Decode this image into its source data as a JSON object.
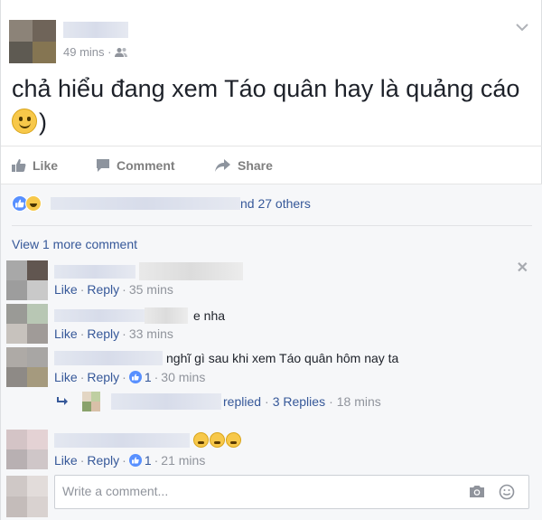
{
  "post": {
    "timestamp": "49 mins · ",
    "audience_icon": "friends-icon",
    "text": "chả hiểu đang xem Táo quân hay là quảng cáo",
    "text_suffix": ")",
    "emoji": "smile-icon"
  },
  "actions": {
    "like": "Like",
    "comment": "Comment",
    "share": "Share"
  },
  "reactions": {
    "summary_suffix": "nd 27 others"
  },
  "view_more": "View 1 more comment",
  "comments": [
    {
      "text": "",
      "like": "Like",
      "reply": "Reply",
      "time": "35 mins"
    },
    {
      "text": "e nha",
      "like": "Like",
      "reply": "Reply",
      "time": "33 mins"
    },
    {
      "text": "nghĩ gì sau khi xem Táo quân hôm nay ta",
      "like": "Like",
      "reply": "Reply",
      "like_count": "1",
      "time": "30 mins",
      "replies_text": "replied",
      "replies_link": "3 Replies",
      "replies_time": "18 mins"
    },
    {
      "text": "",
      "like": "Like",
      "reply": "Reply",
      "like_count": "1",
      "time": "21 mins"
    }
  ],
  "composer": {
    "placeholder": "Write a comment..."
  },
  "colors": {
    "link": "#365899",
    "muted": "#90949c",
    "accent": "#5890ff"
  }
}
